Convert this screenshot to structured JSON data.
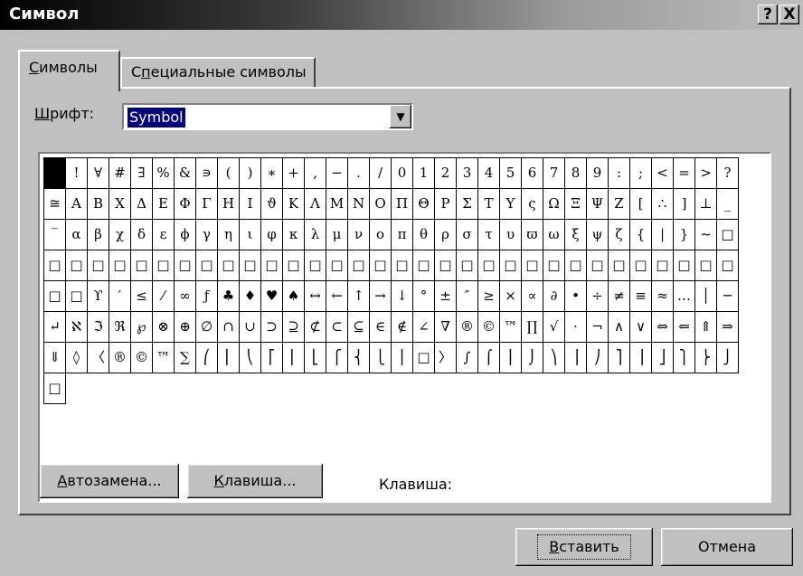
{
  "window": {
    "title": "Символ",
    "help": "?",
    "close": "X"
  },
  "tabs": [
    {
      "label": "Символы",
      "hotkey": "С",
      "rest": "имволы"
    },
    {
      "label": "Специальные символы",
      "prefix": "С",
      "hotkey": "п",
      "rest": "ециальные символы"
    }
  ],
  "font": {
    "label": "Шрифт:",
    "hotkey": "Ш",
    "rest": "рифт:",
    "value": "Symbol",
    "arrow": "▼"
  },
  "symbols": [
    [
      "",
      "!",
      "∀",
      "#",
      "∃",
      "%",
      "&",
      "∍",
      "(",
      ")",
      "∗",
      "+",
      ",",
      "−",
      ".",
      "/",
      "0",
      "1",
      "2",
      "3",
      "4",
      "5",
      "6",
      "7",
      "8",
      "9",
      ":",
      ";"
    ],
    [
      "<",
      "=",
      ">",
      "?",
      "≅",
      "Α",
      "Β",
      "Χ",
      "Δ",
      "Ε",
      "Φ",
      "Γ",
      "Η",
      "Ι",
      "ϑ",
      "Κ",
      "Λ",
      "Μ",
      "Ν",
      "Ο",
      "Π",
      "Θ",
      "Ρ",
      "Σ",
      "Τ",
      "Υ",
      "ς",
      "Ω"
    ],
    [
      "Ξ",
      "Ψ",
      "Ζ",
      "[",
      "∴",
      "]",
      "⊥",
      "_",
      "‾",
      "α",
      "β",
      "χ",
      "δ",
      "ε",
      "ϕ",
      "γ",
      "η",
      "ι",
      "φ",
      "κ",
      "λ",
      "μ",
      "ν",
      "ο",
      "π",
      "θ",
      "ρ",
      "σ"
    ],
    [
      "τ",
      "υ",
      "ϖ",
      "ω",
      "ξ",
      "ψ",
      "ζ",
      "{",
      "|",
      "}",
      "~",
      "□",
      "□",
      "□",
      "□",
      "□",
      "□",
      "□",
      "□",
      "□",
      "□",
      "□",
      "□",
      "□",
      "□",
      "□",
      "□",
      "□"
    ],
    [
      "□",
      "□",
      "□",
      "□",
      "□",
      "□",
      "□",
      "□",
      "□",
      "□",
      "□",
      "□",
      "□",
      "□",
      "□",
      "□",
      "□",
      "□",
      "ϒ",
      "′",
      "≤",
      "⁄",
      "∞",
      "ƒ",
      "♣",
      "♦",
      "♥",
      "♠",
      "↔"
    ],
    [
      "←",
      "↑",
      "→",
      "↓",
      "°",
      "±",
      "″",
      "≥",
      "×",
      "∝",
      "∂",
      "•",
      "÷",
      "≠",
      "≡",
      "≈",
      "…",
      "│",
      "─",
      "↵",
      "ℵ",
      "ℑ",
      "ℜ",
      "℘",
      "⊗",
      "⊕",
      "∅",
      "∩"
    ],
    [
      "∪",
      "⊃",
      "⊇",
      "⊄",
      "⊂",
      "⊆",
      "∈",
      "∉",
      "∠",
      "∇",
      "®",
      "©",
      "™",
      "∏",
      "√",
      "⋅",
      "¬",
      "∧",
      "∨",
      "⇔",
      "⇐",
      "⇑",
      "⇒",
      "⇓",
      "◊",
      "〈",
      "®",
      "©"
    ],
    [
      "™",
      "∑",
      "⎛",
      "⎜",
      "⎝",
      "⎡",
      "⎢",
      "⎣",
      "⎧",
      "⎨",
      "⎩",
      "⎪",
      "□",
      "〉",
      "∫",
      "⌠",
      "⎮",
      "⌡",
      "⎞",
      "⎟",
      "⎠",
      "⎤",
      "⎥",
      "⎦",
      "⎫",
      "⎬",
      "⎭",
      "□"
    ]
  ],
  "buttons": {
    "autocorrect": {
      "label": "Автозамена...",
      "hotkey": "А",
      "rest": "втозамена..."
    },
    "shortcut_key": {
      "label": "Клавиша...",
      "hotkey": "К",
      "rest": "лавиша..."
    },
    "insert": {
      "label": "Вставить",
      "hotkey": "В",
      "rest": "ставить"
    },
    "cancel": {
      "label": "Отмена"
    }
  },
  "shortcut_label": "Клавиша:"
}
